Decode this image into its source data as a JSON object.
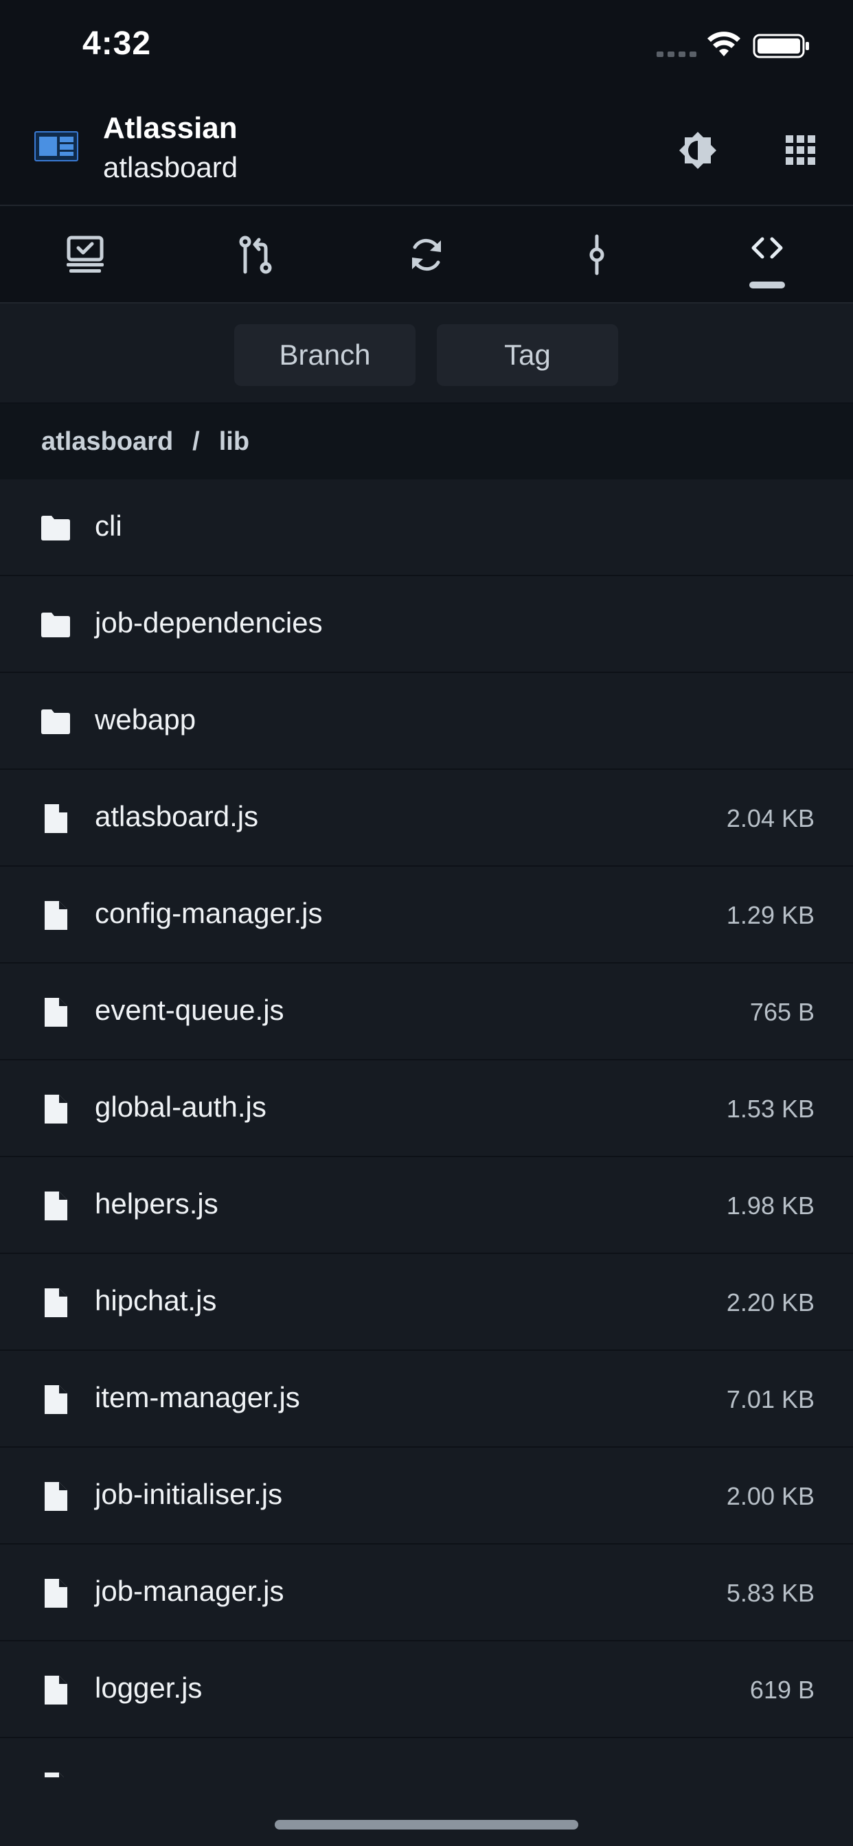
{
  "status_bar": {
    "time": "4:32"
  },
  "header": {
    "owner": "Atlassian",
    "repo": "atlasboard"
  },
  "tabs": [
    {
      "icon": "dashboard-icon"
    },
    {
      "icon": "pull-request-icon"
    },
    {
      "icon": "sync-icon"
    },
    {
      "icon": "commit-icon"
    },
    {
      "icon": "code-icon",
      "active": true
    }
  ],
  "ref_selector": {
    "branch_label": "Branch",
    "tag_label": "Tag"
  },
  "breadcrumb": {
    "root": "atlasboard",
    "separator": "/",
    "current": "lib"
  },
  "files": [
    {
      "type": "folder",
      "name": "cli",
      "size": ""
    },
    {
      "type": "folder",
      "name": "job-dependencies",
      "size": ""
    },
    {
      "type": "folder",
      "name": "webapp",
      "size": ""
    },
    {
      "type": "file",
      "name": "atlasboard.js",
      "size": "2.04 KB"
    },
    {
      "type": "file",
      "name": "config-manager.js",
      "size": "1.29 KB"
    },
    {
      "type": "file",
      "name": "event-queue.js",
      "size": "765 B"
    },
    {
      "type": "file",
      "name": "global-auth.js",
      "size": "1.53 KB"
    },
    {
      "type": "file",
      "name": "helpers.js",
      "size": "1.98 KB"
    },
    {
      "type": "file",
      "name": "hipchat.js",
      "size": "2.20 KB"
    },
    {
      "type": "file",
      "name": "item-manager.js",
      "size": "7.01 KB"
    },
    {
      "type": "file",
      "name": "job-initialiser.js",
      "size": "2.00 KB"
    },
    {
      "type": "file",
      "name": "job-manager.js",
      "size": "5.83 KB"
    },
    {
      "type": "file",
      "name": "logger.js",
      "size": "619 B"
    }
  ],
  "colors": {
    "background": "#161b22",
    "header": "#0d1117",
    "accent": "#1f6feb"
  }
}
